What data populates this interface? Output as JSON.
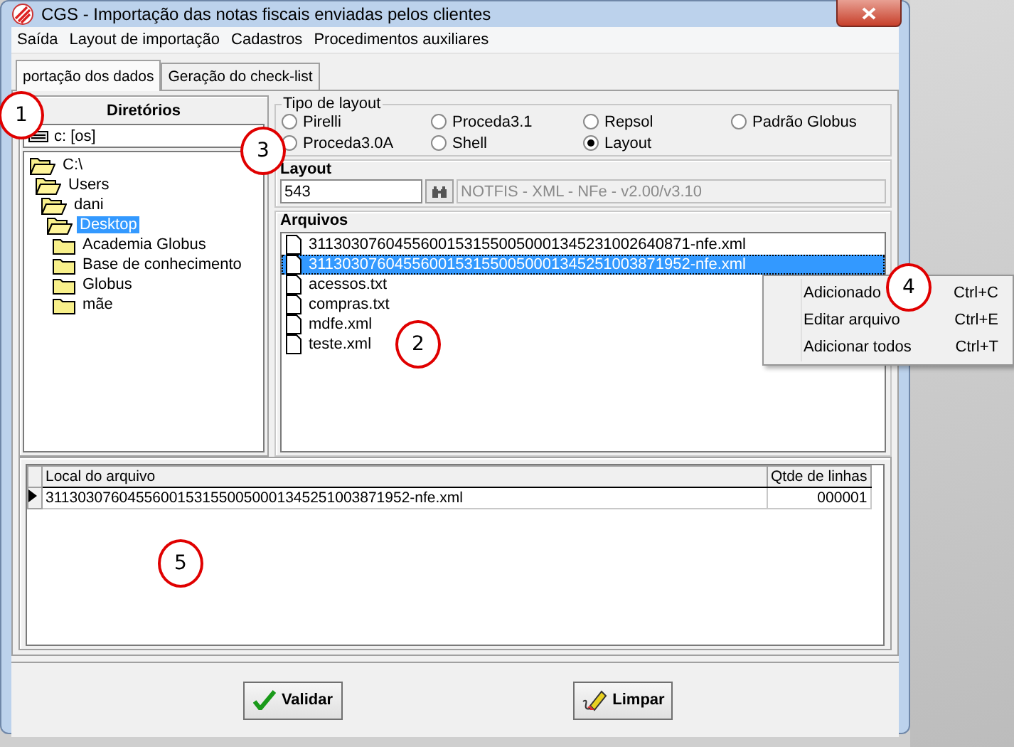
{
  "window": {
    "title": "CGS - Importação das notas fiscais enviadas pelos clientes"
  },
  "menu": [
    "Saída",
    "Layout de importação",
    "Cadastros",
    "Procedimentos auxiliares"
  ],
  "tabs": [
    {
      "label": "portação dos dados",
      "selected": true
    },
    {
      "label": "Geração do check-list",
      "selected": false
    }
  ],
  "directories": {
    "title": "Diretórios",
    "drive": "c: [os]",
    "tree": [
      {
        "label": "C:\\",
        "expanded": true,
        "selected": false,
        "children": [
          {
            "label": "Users",
            "expanded": true,
            "selected": false,
            "children": [
              {
                "label": "dani",
                "expanded": true,
                "selected": false,
                "children": [
                  {
                    "label": "Desktop",
                    "expanded": true,
                    "selected": true,
                    "children": [
                      {
                        "label": "Academia Globus",
                        "expanded": false,
                        "selected": false
                      },
                      {
                        "label": "Base de conhecimento",
                        "expanded": false,
                        "selected": false
                      },
                      {
                        "label": "Globus",
                        "expanded": false,
                        "selected": false
                      },
                      {
                        "label": "mãe",
                        "expanded": false,
                        "selected": false
                      }
                    ]
                  }
                ]
              }
            ]
          }
        ]
      }
    ]
  },
  "layout_type": {
    "title": "Tipo de layout",
    "options": [
      {
        "label": "Pirelli",
        "selected": false
      },
      {
        "label": "Proceda3.1",
        "selected": false
      },
      {
        "label": "Repsol",
        "selected": false
      },
      {
        "label": "Padrão Globus",
        "selected": false
      },
      {
        "label": "Proceda3.0A",
        "selected": false
      },
      {
        "label": "Shell",
        "selected": false
      },
      {
        "label": "Layout",
        "selected": true
      }
    ]
  },
  "layout": {
    "title": "Layout",
    "code": "543",
    "description": "NOTFIS - XML - NFe - v2.00/v3.10"
  },
  "files": {
    "title": "Arquivos",
    "items": [
      {
        "name": "31130307604556001531550050001345231002640871-nfe.xml",
        "selected": false
      },
      {
        "name": "31130307604556001531550050001345251003871952-nfe.xml",
        "selected": true
      },
      {
        "name": "acessos.txt",
        "selected": false
      },
      {
        "name": "compras.txt",
        "selected": false
      },
      {
        "name": "mdfe.xml",
        "selected": false
      },
      {
        "name": "teste.xml",
        "selected": false
      }
    ]
  },
  "context_menu": [
    {
      "label": "Adicionado",
      "shortcut": "Ctrl+C"
    },
    {
      "label": "Editar arquivo",
      "shortcut": "Ctrl+E"
    },
    {
      "label": "Adicionar todos",
      "shortcut": "Ctrl+T"
    }
  ],
  "grid": {
    "columns": [
      "Local do arquivo",
      "Qtde de linhas"
    ],
    "rows": [
      {
        "cells": [
          "31130307604556001531550050001345251003871952-nfe.xml",
          "000001"
        ],
        "current": true
      }
    ]
  },
  "buttons": [
    {
      "label": "Validar",
      "kind": "validate"
    },
    {
      "label": "Limpar",
      "kind": "clear"
    }
  ],
  "annotations": [
    "1",
    "2",
    "3",
    "4",
    "5"
  ]
}
